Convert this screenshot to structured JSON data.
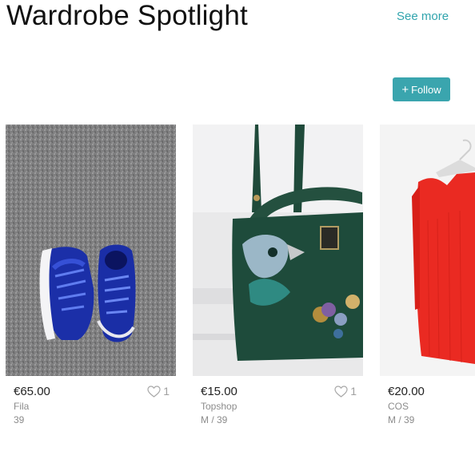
{
  "header": {
    "title": "Wardrobe Spotlight",
    "see_more": "See more",
    "follow_label": "Follow"
  },
  "items": [
    {
      "price": "€65.00",
      "brand": "Fila",
      "size": "39",
      "likes": "1",
      "image": "blue-sneakers-on-grey-carpet"
    },
    {
      "price": "€15.00",
      "brand": "Topshop",
      "size": "M / 39",
      "likes": "1",
      "image": "green-handbag-with-bird-embroidery"
    },
    {
      "price": "€20.00",
      "brand": "COS",
      "size": "M / 39",
      "image": "red-dress-on-hanger"
    }
  ],
  "colors": {
    "accent": "#3aa5ae",
    "link": "#30a4ad",
    "muted": "#8c8c8c"
  }
}
